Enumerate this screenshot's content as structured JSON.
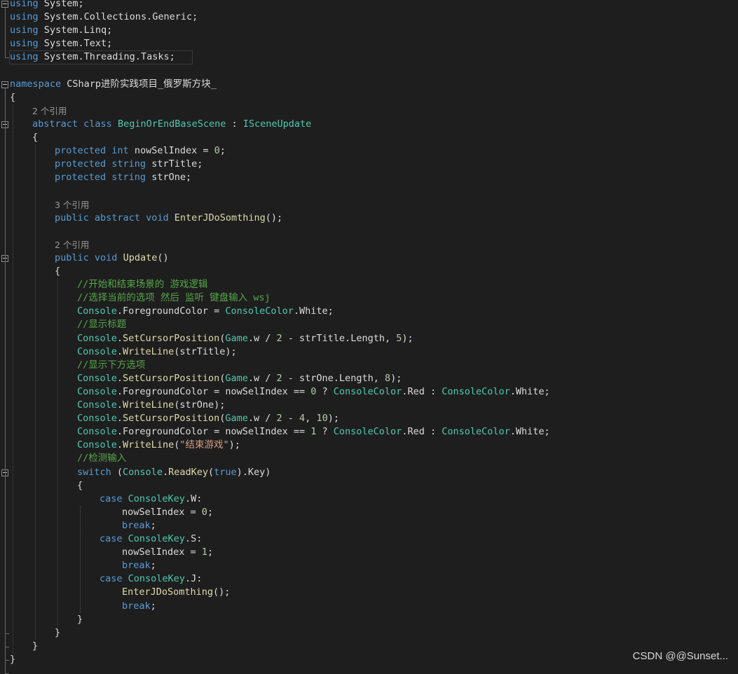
{
  "colors": {
    "background": "#1e1e1e",
    "keyword": "#569cd6",
    "type": "#4ec9b0",
    "method": "#dcdcaa",
    "comment": "#57a64a",
    "string": "#d69d85",
    "number": "#b5cea8",
    "codelens": "#999999",
    "plain": "#dcdcdc"
  },
  "editor": {
    "lines": [
      {
        "indent": 0,
        "fold": true,
        "tokens": [
          [
            "using",
            "kw"
          ],
          [
            " System;",
            "pl"
          ]
        ]
      },
      {
        "indent": 0,
        "tokens": [
          [
            "using",
            "kw"
          ],
          [
            " System.Collections.Generic;",
            "pl"
          ]
        ]
      },
      {
        "indent": 0,
        "tokens": [
          [
            "using",
            "kw"
          ],
          [
            " System.Linq;",
            "pl"
          ]
        ]
      },
      {
        "indent": 0,
        "tokens": [
          [
            "using",
            "kw"
          ],
          [
            " System.Text;",
            "pl"
          ]
        ]
      },
      {
        "indent": 0,
        "tokens": [
          [
            "using",
            "kw"
          ],
          [
            " System.Threading.Tasks;",
            "pl"
          ]
        ]
      },
      {
        "indent": 0,
        "tokens": []
      },
      {
        "indent": 0,
        "fold": true,
        "tokens": [
          [
            "namespace",
            "kw"
          ],
          [
            " CSharp进阶实践项目_俄罗斯方块_",
            "pl"
          ]
        ]
      },
      {
        "indent": 0,
        "tokens": [
          [
            "{",
            "pl"
          ]
        ]
      },
      {
        "indent": 1,
        "lens": true,
        "tokens": [
          [
            "2 个引用",
            "lens"
          ]
        ]
      },
      {
        "indent": 1,
        "fold": true,
        "tokens": [
          [
            "abstract",
            "kw"
          ],
          [
            " ",
            "pl"
          ],
          [
            "class",
            "kw"
          ],
          [
            " ",
            "pl"
          ],
          [
            "BeginOrEndBaseScene",
            "ty"
          ],
          [
            " : ",
            "pl"
          ],
          [
            "ISceneUpdate",
            "it"
          ]
        ]
      },
      {
        "indent": 1,
        "tokens": [
          [
            "{",
            "pl"
          ]
        ]
      },
      {
        "indent": 2,
        "tokens": [
          [
            "protected",
            "kw"
          ],
          [
            " ",
            "pl"
          ],
          [
            "int",
            "kw"
          ],
          [
            " nowSelIndex = ",
            "pl"
          ],
          [
            "0",
            "nu"
          ],
          [
            ";",
            "pl"
          ]
        ]
      },
      {
        "indent": 2,
        "tokens": [
          [
            "protected",
            "kw"
          ],
          [
            " ",
            "pl"
          ],
          [
            "string",
            "kw"
          ],
          [
            " strTitle;",
            "pl"
          ]
        ]
      },
      {
        "indent": 2,
        "tokens": [
          [
            "protected",
            "kw"
          ],
          [
            " ",
            "pl"
          ],
          [
            "string",
            "kw"
          ],
          [
            " strOne;",
            "pl"
          ]
        ]
      },
      {
        "indent": 2,
        "tokens": []
      },
      {
        "indent": 2,
        "lens": true,
        "tokens": [
          [
            "3 个引用",
            "lens"
          ]
        ]
      },
      {
        "indent": 2,
        "tokens": [
          [
            "public",
            "kw"
          ],
          [
            " ",
            "pl"
          ],
          [
            "abstract",
            "kw"
          ],
          [
            " ",
            "pl"
          ],
          [
            "void",
            "kw"
          ],
          [
            " ",
            "pl"
          ],
          [
            "EnterJDoSomthing",
            "me"
          ],
          [
            "();",
            "pl"
          ]
        ]
      },
      {
        "indent": 2,
        "tokens": []
      },
      {
        "indent": 2,
        "lens": true,
        "tokens": [
          [
            "2 个引用",
            "lens"
          ]
        ]
      },
      {
        "indent": 2,
        "fold": true,
        "tokens": [
          [
            "public",
            "kw"
          ],
          [
            " ",
            "pl"
          ],
          [
            "void",
            "kw"
          ],
          [
            " ",
            "pl"
          ],
          [
            "Update",
            "me"
          ],
          [
            "()",
            "pl"
          ]
        ]
      },
      {
        "indent": 2,
        "tokens": [
          [
            "{",
            "pl"
          ]
        ]
      },
      {
        "indent": 3,
        "tokens": [
          [
            "//开始和结束场景的 游戏逻辑",
            "cm"
          ]
        ]
      },
      {
        "indent": 3,
        "tokens": [
          [
            "//选择当前的选项 然后 监听 键盘输入 wsj",
            "cm"
          ]
        ]
      },
      {
        "indent": 3,
        "tokens": [
          [
            "Console",
            "ty"
          ],
          [
            ".ForegroundColor = ",
            "pl"
          ],
          [
            "ConsoleColor",
            "ty"
          ],
          [
            ".White;",
            "pl"
          ]
        ]
      },
      {
        "indent": 3,
        "tokens": [
          [
            "//显示标题",
            "cm"
          ]
        ]
      },
      {
        "indent": 3,
        "tokens": [
          [
            "Console",
            "ty"
          ],
          [
            ".",
            "pl"
          ],
          [
            "SetCursorPosition",
            "me"
          ],
          [
            "(",
            "pl"
          ],
          [
            "Game",
            "ty"
          ],
          [
            ".w / ",
            "pl"
          ],
          [
            "2",
            "nu"
          ],
          [
            " - strTitle.Length, ",
            "pl"
          ],
          [
            "5",
            "nu"
          ],
          [
            ");",
            "pl"
          ]
        ]
      },
      {
        "indent": 3,
        "tokens": [
          [
            "Console",
            "ty"
          ],
          [
            ".",
            "pl"
          ],
          [
            "WriteLine",
            "me"
          ],
          [
            "(strTitle);",
            "pl"
          ]
        ]
      },
      {
        "indent": 3,
        "tokens": [
          [
            "//显示下方选项",
            "cm"
          ]
        ]
      },
      {
        "indent": 3,
        "tokens": [
          [
            "Console",
            "ty"
          ],
          [
            ".",
            "pl"
          ],
          [
            "SetCursorPosition",
            "me"
          ],
          [
            "(",
            "pl"
          ],
          [
            "Game",
            "ty"
          ],
          [
            ".w / ",
            "pl"
          ],
          [
            "2",
            "nu"
          ],
          [
            " - strOne.Length, ",
            "pl"
          ],
          [
            "8",
            "nu"
          ],
          [
            ");",
            "pl"
          ]
        ]
      },
      {
        "indent": 3,
        "tokens": [
          [
            "Console",
            "ty"
          ],
          [
            ".ForegroundColor = nowSelIndex == ",
            "pl"
          ],
          [
            "0",
            "nu"
          ],
          [
            " ? ",
            "pl"
          ],
          [
            "ConsoleColor",
            "ty"
          ],
          [
            ".Red : ",
            "pl"
          ],
          [
            "ConsoleColor",
            "ty"
          ],
          [
            ".White;",
            "pl"
          ]
        ]
      },
      {
        "indent": 3,
        "tokens": [
          [
            "Console",
            "ty"
          ],
          [
            ".",
            "pl"
          ],
          [
            "WriteLine",
            "me"
          ],
          [
            "(strOne);",
            "pl"
          ]
        ]
      },
      {
        "indent": 3,
        "tokens": [
          [
            "Console",
            "ty"
          ],
          [
            ".",
            "pl"
          ],
          [
            "SetCursorPosition",
            "me"
          ],
          [
            "(",
            "pl"
          ],
          [
            "Game",
            "ty"
          ],
          [
            ".w / ",
            "pl"
          ],
          [
            "2",
            "nu"
          ],
          [
            " - ",
            "pl"
          ],
          [
            "4",
            "nu"
          ],
          [
            ", ",
            "pl"
          ],
          [
            "10",
            "nu"
          ],
          [
            ");",
            "pl"
          ]
        ]
      },
      {
        "indent": 3,
        "tokens": [
          [
            "Console",
            "ty"
          ],
          [
            ".ForegroundColor = nowSelIndex == ",
            "pl"
          ],
          [
            "1",
            "nu"
          ],
          [
            " ? ",
            "pl"
          ],
          [
            "ConsoleColor",
            "ty"
          ],
          [
            ".Red : ",
            "pl"
          ],
          [
            "ConsoleColor",
            "ty"
          ],
          [
            ".White;",
            "pl"
          ]
        ]
      },
      {
        "indent": 3,
        "tokens": [
          [
            "Console",
            "ty"
          ],
          [
            ".",
            "pl"
          ],
          [
            "WriteLine",
            "me"
          ],
          [
            "(",
            "pl"
          ],
          [
            "\"结束游戏\"",
            "st"
          ],
          [
            ");",
            "pl"
          ]
        ]
      },
      {
        "indent": 3,
        "tokens": [
          [
            "//检测输入",
            "cm"
          ]
        ]
      },
      {
        "indent": 3,
        "fold": true,
        "tokens": [
          [
            "switch",
            "kw"
          ],
          [
            " (",
            "pl"
          ],
          [
            "Console",
            "ty"
          ],
          [
            ".",
            "pl"
          ],
          [
            "ReadKey",
            "me"
          ],
          [
            "(",
            "pl"
          ],
          [
            "true",
            "kw"
          ],
          [
            ").Key)",
            "pl"
          ]
        ]
      },
      {
        "indent": 3,
        "tokens": [
          [
            "{",
            "pl"
          ]
        ]
      },
      {
        "indent": 4,
        "tokens": [
          [
            "case",
            "kw"
          ],
          [
            " ",
            "pl"
          ],
          [
            "ConsoleKey",
            "ty"
          ],
          [
            ".W:",
            "pl"
          ]
        ]
      },
      {
        "indent": 5,
        "tokens": [
          [
            "nowSelIndex = ",
            "pl"
          ],
          [
            "0",
            "nu"
          ],
          [
            ";",
            "pl"
          ]
        ]
      },
      {
        "indent": 5,
        "tokens": [
          [
            "break",
            "kw"
          ],
          [
            ";",
            "pl"
          ]
        ]
      },
      {
        "indent": 4,
        "tokens": [
          [
            "case",
            "kw"
          ],
          [
            " ",
            "pl"
          ],
          [
            "ConsoleKey",
            "ty"
          ],
          [
            ".S:",
            "pl"
          ]
        ]
      },
      {
        "indent": 5,
        "tokens": [
          [
            "nowSelIndex = ",
            "pl"
          ],
          [
            "1",
            "nu"
          ],
          [
            ";",
            "pl"
          ]
        ]
      },
      {
        "indent": 5,
        "tokens": [
          [
            "break",
            "kw"
          ],
          [
            ";",
            "pl"
          ]
        ]
      },
      {
        "indent": 4,
        "tokens": [
          [
            "case",
            "kw"
          ],
          [
            " ",
            "pl"
          ],
          [
            "ConsoleKey",
            "ty"
          ],
          [
            ".J:",
            "pl"
          ]
        ]
      },
      {
        "indent": 5,
        "tokens": [
          [
            "EnterJDoSomthing",
            "me"
          ],
          [
            "();",
            "pl"
          ]
        ]
      },
      {
        "indent": 5,
        "tokens": [
          [
            "break",
            "kw"
          ],
          [
            ";",
            "pl"
          ]
        ]
      },
      {
        "indent": 3,
        "tokens": [
          [
            "}",
            "pl"
          ]
        ]
      },
      {
        "indent": 2,
        "tokens": [
          [
            "}",
            "pl"
          ]
        ]
      },
      {
        "indent": 1,
        "tokens": [
          [
            "}",
            "pl"
          ]
        ]
      },
      {
        "indent": 0,
        "tokens": [
          [
            "}",
            "pl"
          ]
        ]
      }
    ]
  },
  "watermark": "CSDN @@Sunset..."
}
